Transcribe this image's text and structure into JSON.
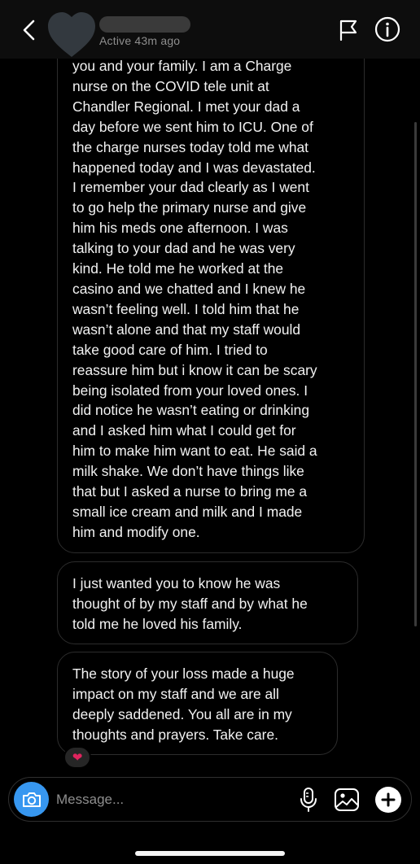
{
  "header": {
    "back_icon": "chevron-left-icon",
    "status": "Active 43m ago",
    "flag_icon": "flag-icon",
    "info_icon": "info-icon"
  },
  "messages": [
    {
      "lines": [
        "you and your family. I am a Charge",
        "nurse on the COVID tele unit at",
        "Chandler Regional. I met your dad a",
        "day before we sent him to ICU. One of",
        "the charge nurses today told me what",
        "happened today and I was devastated.",
        "I remember your dad clearly as I went",
        "to go help the primary nurse and give",
        "him his meds one afternoon. I was",
        "talking to your dad and he was very",
        "kind. He told me he worked at the",
        "casino and we chatted and I knew he",
        "wasn’t feeling well. I told him that he",
        "wasn’t alone and that my staff would",
        "take good care of him. I tried to",
        "reassure him but i know it can be scary",
        "being isolated from your loved ones. I",
        "did notice he wasn’t eating or drinking",
        "and I asked him what I could get for",
        "him to make him want to eat. He said a",
        "milk shake. We don’t have things like",
        "that but I asked a nurse to bring me a",
        "small ice cream and milk and I made",
        "him and modify one."
      ]
    },
    {
      "lines": [
        "I just wanted you to know he was",
        "thought of by my staff and by what he",
        "told me he loved his family."
      ]
    },
    {
      "lines": [
        "The story of your loss made a huge",
        "impact on my staff and we are all",
        "deeply saddened. You all are in my",
        "thoughts and prayers. Take care."
      ],
      "reaction": "❤"
    }
  ],
  "composer": {
    "placeholder": "Message...",
    "camera_icon": "camera-icon",
    "mic_icon": "microphone-icon",
    "gallery_icon": "gallery-icon",
    "plus_icon": "plus-icon"
  },
  "colors": {
    "background": "#000000",
    "header": "#0d0d0d",
    "bubble_border": "#2c2c2c",
    "accent": "#3797f0",
    "reaction": "#e0245e"
  }
}
